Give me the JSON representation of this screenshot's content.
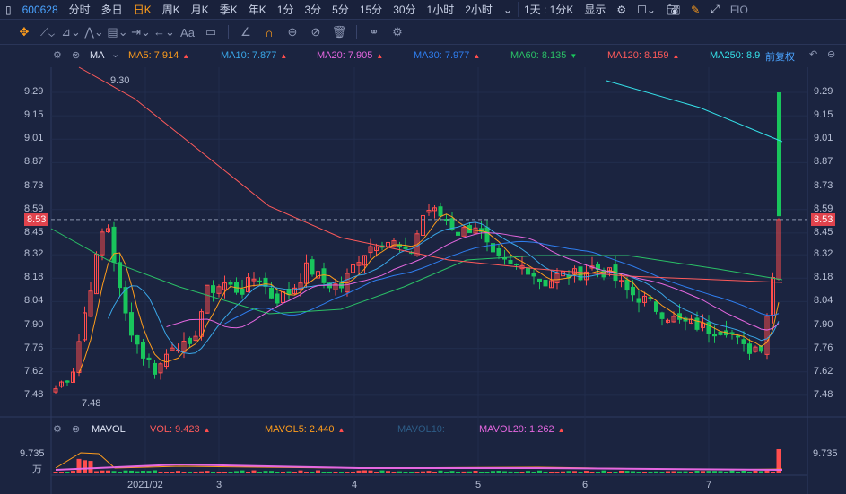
{
  "toolbar": {
    "stock_code": "600628",
    "periods": [
      "分时",
      "多日",
      "日K",
      "周K",
      "月K",
      "季K",
      "年K",
      "1分",
      "3分",
      "5分",
      "15分",
      "30分",
      "1小时",
      "2小时"
    ],
    "active_period": "日K",
    "combo": "1天 : 1分K",
    "display": "显示",
    "fio": "FIO"
  },
  "ma_legend": {
    "label": "MA",
    "items": [
      {
        "name": "MA5: 7.914",
        "color": "#ff9d1c",
        "trend": "up"
      },
      {
        "name": "MA10: 7.877",
        "color": "#3aa7e8",
        "trend": "up"
      },
      {
        "name": "MA20: 7.905",
        "color": "#e567e0",
        "trend": "up"
      },
      {
        "name": "MA30: 7.977",
        "color": "#2f7ef0",
        "trend": "up"
      },
      {
        "name": "MA60: 8.135",
        "color": "#2ac066",
        "trend": "down"
      },
      {
        "name": "MA120: 8.159",
        "color": "#ff5a5a",
        "trend": "up"
      },
      {
        "name": "MA250: 8.9",
        "color": "#35e0e8",
        "trend": ""
      }
    ],
    "adjust": "前复权"
  },
  "price_axis": [
    "9.29",
    "9.15",
    "9.01",
    "8.87",
    "8.73",
    "8.59",
    "8.45",
    "8.32",
    "8.18",
    "8.04",
    "7.90",
    "7.76",
    "7.62",
    "7.48"
  ],
  "current_price": "8.53",
  "high_label": "9.30",
  "low_label": "7.48",
  "vol_legend": {
    "label": "MAVOL",
    "items": [
      {
        "name": "VOL: 9.423",
        "color": "#ff5a5a",
        "trend": "up"
      },
      {
        "name": "MAVOL5: 2.440",
        "color": "#ff9d1c",
        "trend": "up"
      },
      {
        "name": "MAVOL10:",
        "color": "#2d5c86",
        "trend": ""
      },
      {
        "name": "MAVOL20: 1.262",
        "color": "#e567e0",
        "trend": "up"
      }
    ]
  },
  "vol_axis": {
    "max": "9.735",
    "unit": "万"
  },
  "x_axis": [
    "2021/02",
    "3",
    "4",
    "5",
    "6",
    "7"
  ],
  "price_anchors": [
    7.52,
    7.62,
    8.1,
    8.55,
    8.0,
    7.75,
    7.62,
    7.8,
    7.75,
    8.1,
    8.15,
    8.1,
    8.2,
    8.05,
    8.1,
    8.25,
    8.15,
    8.13,
    8.3,
    8.4,
    8.4,
    8.3,
    8.6,
    8.55,
    8.45,
    8.5,
    8.3,
    8.25,
    8.25,
    8.15,
    8.2,
    8.2,
    8.25,
    8.2,
    8.1,
    8.05,
    7.98,
    7.92,
    7.9,
    7.87,
    7.88,
    7.75,
    7.78,
    8.4
  ]
}
